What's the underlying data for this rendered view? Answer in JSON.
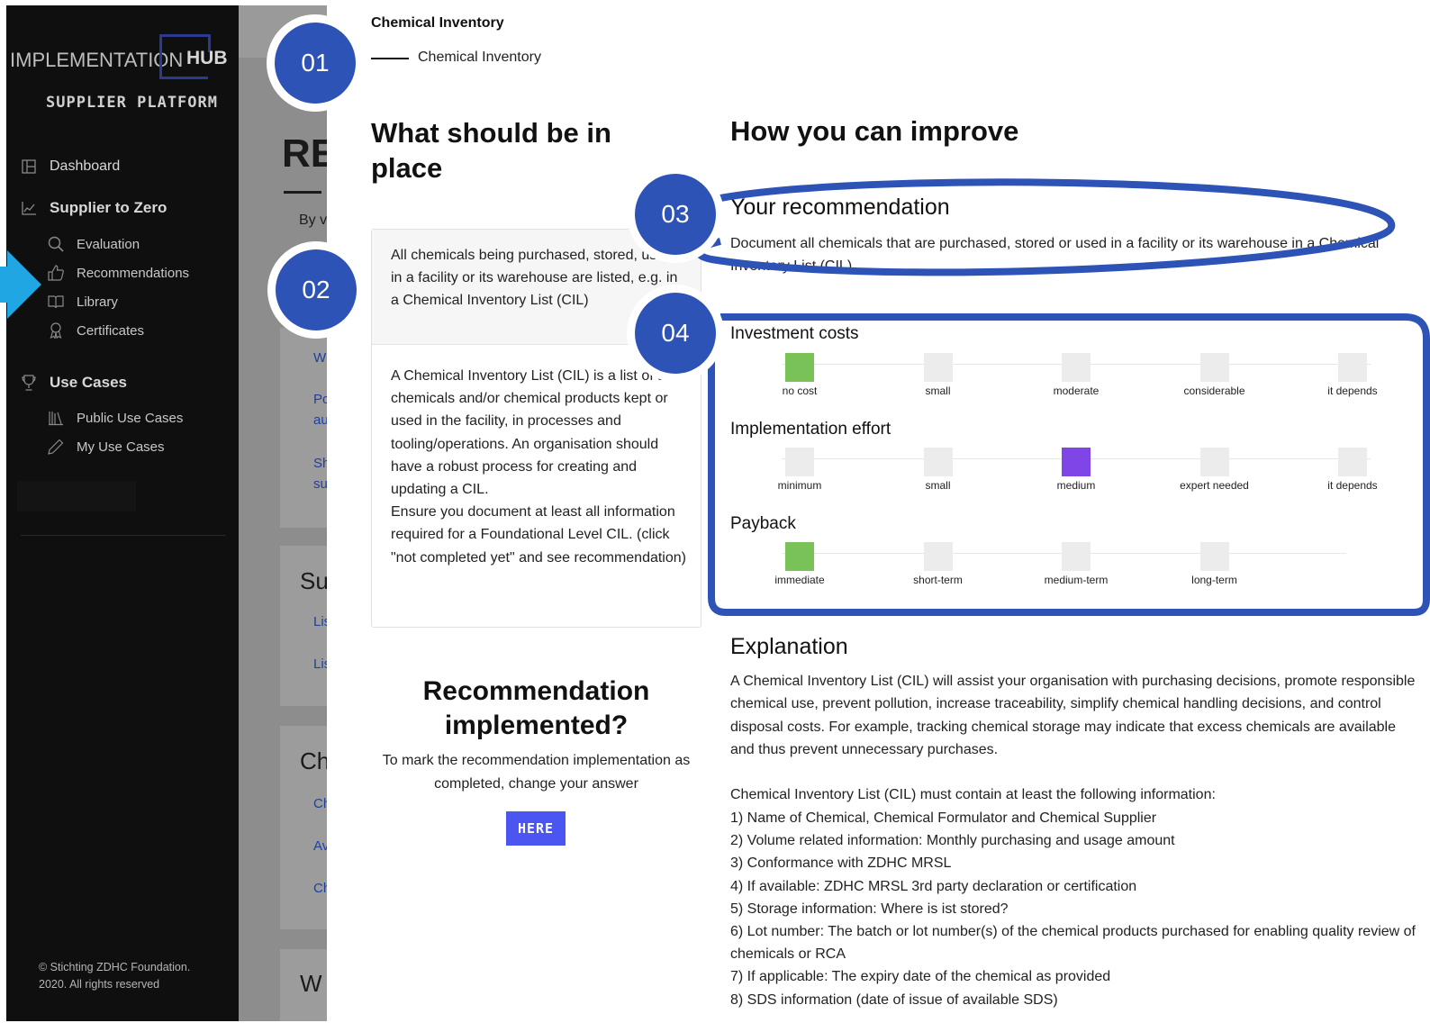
{
  "sidebar": {
    "logo_left": "IMPLEMENTATION",
    "logo_right": "HUB",
    "platform": "SUPPLIER PLATFORM",
    "items": [
      {
        "label": "Dashboard",
        "icon": "grid-icon"
      },
      {
        "label": "Supplier to Zero",
        "icon": "chart-icon"
      },
      {
        "label": "Evaluation",
        "icon": "magnifier-icon"
      },
      {
        "label": "Recommendations",
        "icon": "thumbs-up-icon"
      },
      {
        "label": "Library",
        "icon": "book-icon"
      },
      {
        "label": "Certificates",
        "icon": "award-icon"
      },
      {
        "label": "Use Cases",
        "icon": "trophy-icon"
      },
      {
        "label": "Public Use Cases",
        "icon": "library-icon"
      },
      {
        "label": "My Use Cases",
        "icon": "pencil-icon"
      }
    ],
    "copyright": "© Stichting ZDHC Foundation. 2020. All rights reserved"
  },
  "background": {
    "title_fragment": "RE",
    "subtitle_fragment": "By v",
    "link_fragments": [
      "W",
      "Pc",
      "au",
      "Sh",
      "su",
      "Lis",
      "Lis",
      "Ch",
      "Av",
      "Ch"
    ],
    "heading_fragments": [
      "Su",
      "Ch",
      "W"
    ]
  },
  "modal": {
    "breadcrumb_title": "Chemical Inventory",
    "breadcrumb_sub": "Chemical Inventory",
    "left_heading": "What should be in place",
    "requirement_short": "All chemicals being purchased, stored, used in a facility or its warehouse are listed, e.g. in a Chemical Inventory List (CIL)",
    "requirement_long": "A Chemical Inventory List (CIL) is a list of all chemicals and/or chemical products kept or used in the facility, in processes and tooling/operations. An organisation should have a robust process for creating and updating a CIL.\nEnsure you document at least all information required for a Foundational Level CIL. (click \"not completed yet\" and see recommendation)",
    "implemented_heading": "Recommendation implemented?",
    "implemented_text": "To mark the recommendation implementation as completed, change your answer",
    "here_button": "HERE",
    "right_heading": "How you can improve",
    "recommendation_title": "Your recommendation",
    "recommendation_text": "Document all chemicals that are purchased, stored or used in a facility or its warehouse in a Chemical Inventory List (CIL)",
    "ratings": [
      {
        "title": "Investment costs",
        "options": [
          "no cost",
          "small",
          "moderate",
          "considerable",
          "it depends"
        ],
        "selected": 0,
        "selected_color": "#79c257"
      },
      {
        "title": "Implementation effort",
        "options": [
          "minimum",
          "small",
          "medium",
          "expert needed",
          "it depends"
        ],
        "selected": 2,
        "selected_color": "#7f45e6"
      },
      {
        "title": "Payback",
        "options": [
          "immediate",
          "short-term",
          "medium-term",
          "long-term"
        ],
        "selected": 0,
        "selected_color": "#79c257"
      }
    ],
    "explanation_title": "Explanation",
    "explanation_text": "A Chemical Inventory List (CIL) will assist your organisation with purchasing decisions, promote responsible chemical use, prevent pollution, increase traceability, simplify chemical handling decisions, and control disposal costs. For example, tracking chemical storage may indicate that excess chemicals are available and thus prevent unnecessary purchases.",
    "list_intro": "Chemical Inventory List (CIL) must contain at least the following information:",
    "list_items": [
      "1) Name of Chemical, Chemical Formulator and Chemical Supplier",
      "2) Volume related information: Monthly purchasing and usage amount",
      "3) Conformance with ZDHC MRSL",
      "4) If available: ZDHC MRSL 3rd party declaration or certification",
      "5) Storage information: Where is ist stored?",
      "6) Lot number: The batch or lot number(s) of the chemical products purchased for enabling quality review of chemicals or RCA",
      "7) If applicable: The expiry date of the chemical as provided",
      "8) SDS information (date of issue of available SDS)"
    ]
  },
  "annotations": {
    "badges": [
      "01",
      "02",
      "03",
      "04"
    ],
    "color": "#2d53b7"
  }
}
